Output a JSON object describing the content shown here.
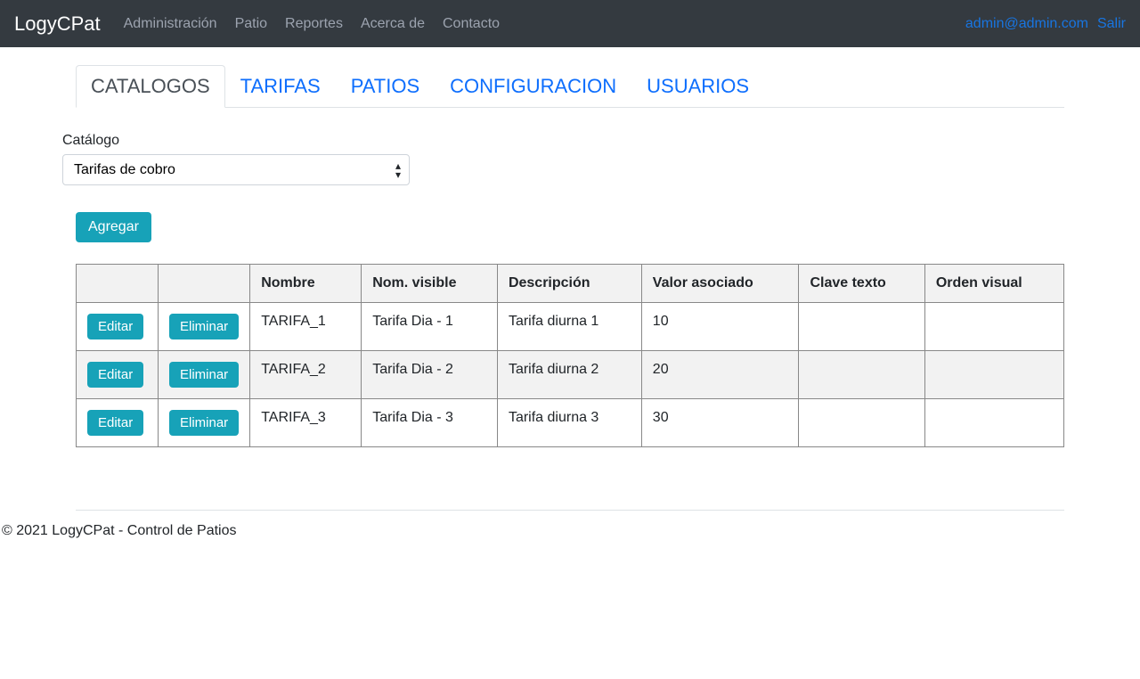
{
  "navbar": {
    "brand": "LogyCPat",
    "links": [
      "Administración",
      "Patio",
      "Reportes",
      "Acerca de",
      "Contacto"
    ],
    "user": "admin@admin.com",
    "logout": "Salir"
  },
  "tabs": [
    {
      "label": "CATALOGOS",
      "active": true
    },
    {
      "label": "TARIFAS",
      "active": false
    },
    {
      "label": "PATIOS",
      "active": false
    },
    {
      "label": "CONFIGURACION",
      "active": false
    },
    {
      "label": "USUARIOS",
      "active": false
    }
  ],
  "catalog": {
    "label": "Catálogo",
    "selected": "Tarifas de cobro"
  },
  "buttons": {
    "add": "Agregar",
    "edit": "Editar",
    "delete": "Eliminar"
  },
  "table": {
    "headers": [
      "Nombre",
      "Nom. visible",
      "Descripción",
      "Valor asociado",
      "Clave texto",
      "Orden visual"
    ],
    "rows": [
      {
        "nombre": "TARIFA_1",
        "visible": "Tarifa Dia - 1",
        "descripcion": "Tarifa diurna 1",
        "valor": "10",
        "clave": "",
        "orden": ""
      },
      {
        "nombre": "TARIFA_2",
        "visible": "Tarifa Dia - 2",
        "descripcion": "Tarifa diurna 2",
        "valor": "20",
        "clave": "",
        "orden": ""
      },
      {
        "nombre": "TARIFA_3",
        "visible": "Tarifa Dia - 3",
        "descripcion": "Tarifa diurna 3",
        "valor": "30",
        "clave": "",
        "orden": ""
      }
    ]
  },
  "footer": "© 2021 LogyCPat - Control de Patios"
}
